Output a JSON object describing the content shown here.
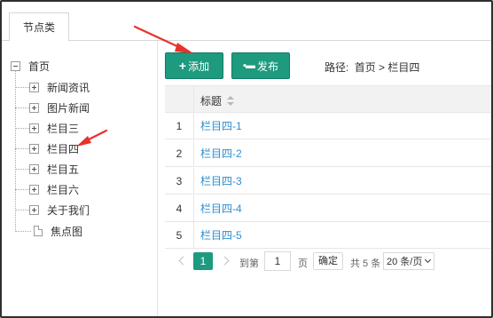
{
  "tabs": [
    {
      "label": "节点类"
    }
  ],
  "tree": {
    "root": {
      "label": "首页"
    },
    "items": [
      {
        "label": "新闻资讯",
        "type": "folder"
      },
      {
        "label": "图片新闻",
        "type": "folder"
      },
      {
        "label": "栏目三",
        "type": "folder"
      },
      {
        "label": "栏目四",
        "type": "folder"
      },
      {
        "label": "栏目五",
        "type": "folder"
      },
      {
        "label": "栏目六",
        "type": "folder"
      },
      {
        "label": "关于我们",
        "type": "folder"
      },
      {
        "label": "焦点图",
        "type": "document"
      }
    ]
  },
  "toolbar": {
    "add_label": "添加",
    "add_icon": "plus-icon",
    "publish_label": "发布",
    "publish_icon": "publish-icon",
    "accent_color": "#1e9a7f"
  },
  "breadcrumb": {
    "prefix": "路径:",
    "path": "首页 > 栏目四"
  },
  "table": {
    "columns": [
      {
        "label": ""
      },
      {
        "label": "标题"
      }
    ],
    "rows": [
      {
        "index": "1",
        "title": "栏目四-1"
      },
      {
        "index": "2",
        "title": "栏目四-2"
      },
      {
        "index": "3",
        "title": "栏目四-3"
      },
      {
        "index": "4",
        "title": "栏目四-4"
      },
      {
        "index": "5",
        "title": "栏目四-5"
      }
    ],
    "link_color": "#2e8fd1"
  },
  "pagination": {
    "current_page": "1",
    "goto_label": "到第",
    "page_input_value": "1",
    "page_unit": "页",
    "confirm_label": "确定",
    "total_text": "共 5 条",
    "page_size_option": "20 条/页"
  },
  "annotation_color": "#e8322b"
}
